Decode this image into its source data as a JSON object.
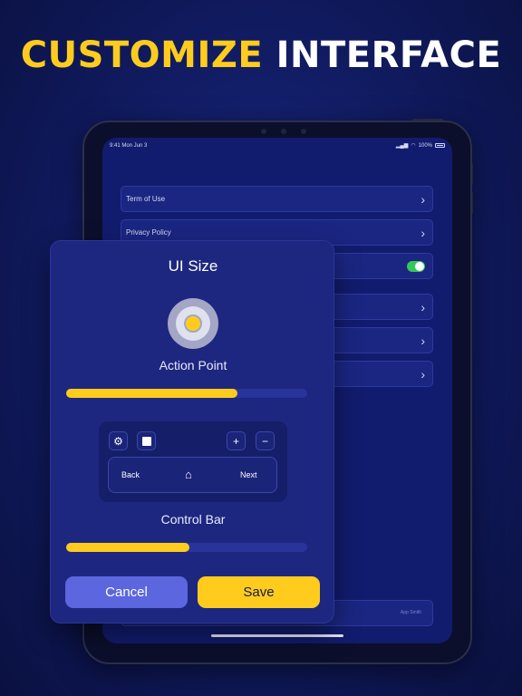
{
  "headline": {
    "part1": "CUSTOMIZE",
    "part2": "INTERFACE"
  },
  "colors": {
    "accent": "#ffcc1e",
    "background": "#101a5e",
    "modal": "#1d2780",
    "cancel": "#5b66df",
    "toggle_on": "#34c759"
  },
  "status_bar": {
    "time": "9:41 Mon Jun 3",
    "battery": "100%"
  },
  "settings": {
    "rows": [
      {
        "label": "Term of Use",
        "icon": "chevron-right-icon"
      },
      {
        "label": "Privacy Policy",
        "icon": "chevron-right-icon"
      }
    ],
    "toggle_on": true,
    "bottom_faint": "App Smith"
  },
  "modal": {
    "title": "UI Size",
    "action_point": {
      "label": "Action Point",
      "size": 0.71
    },
    "control_bar": {
      "label": "Control Bar",
      "size": 0.51,
      "icons": [
        "gear-icon",
        "stop-icon",
        "plus-icon",
        "minus-icon",
        "home-icon"
      ],
      "plus": "+",
      "minus": "−",
      "back": "Back",
      "next": "Next"
    },
    "cancel": "Cancel",
    "save": "Save"
  }
}
